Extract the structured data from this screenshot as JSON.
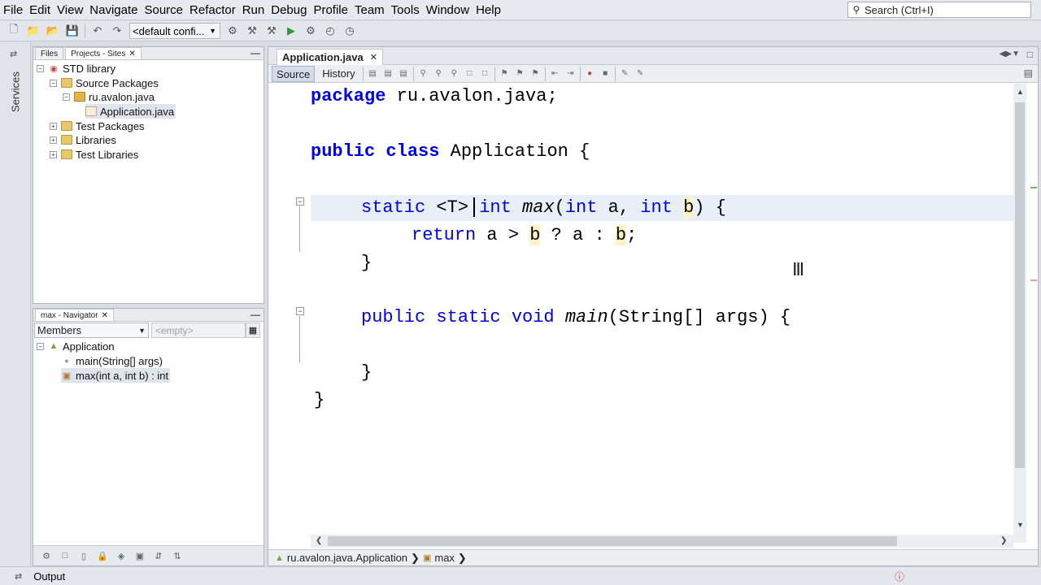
{
  "menu": [
    "File",
    "Edit",
    "View",
    "Navigate",
    "Source",
    "Refactor",
    "Run",
    "Debug",
    "Profile",
    "Team",
    "Tools",
    "Window",
    "Help"
  ],
  "search": {
    "placeholder": "Search (Ctrl+I)"
  },
  "toolbar": {
    "config": "<default confi..."
  },
  "left_strip": {
    "services": "Services"
  },
  "projects": {
    "tabs": [
      "Files",
      "Projects - Sites"
    ],
    "tree": [
      "STD library",
      "Source Packages",
      "ru.avalon.java",
      "Application.java",
      "Test Packages",
      "Libraries",
      "Test Libraries"
    ]
  },
  "navigator": {
    "title": "max - Navigator",
    "members": "Members",
    "filter_placeholder": "<empty>",
    "items": [
      "Application",
      "main(String[] args)",
      "max(int a, int b) : int"
    ]
  },
  "editor": {
    "tab": "Application.java",
    "modes": [
      "Source",
      "History"
    ],
    "code": {
      "l1_kw": "package",
      "l1_rest": " ru.avalon.java;",
      "l2_kw": "public class",
      "l2_rest": " Application {",
      "l3_a": "static",
      "l3_b": " <T> ",
      "l3_c": "int",
      "l3_d": "max",
      "l3_e": "(",
      "l3_f": "int",
      "l3_g": " a, ",
      "l3_h": "int",
      "l3_i": " ",
      "l3_j": "b",
      "l3_k": ") {",
      "l4_kw": "return",
      "l4_a": " a > ",
      "l4_b": "b",
      "l4_c": " ? a : ",
      "l4_d": "b",
      "l4_e": ";",
      "l5": "}",
      "l6_kw": "public static void",
      "l6_fn": "main",
      "l6_rest": "(String[] args) {",
      "l7": "}",
      "l8": "}"
    },
    "breadcrumb": [
      "ru.avalon.java.Application",
      "max"
    ]
  },
  "status": {
    "output": "Output"
  },
  "colors": {
    "keyword": "#0000e6",
    "current_line": "#e9eff8",
    "param_highlight": "#fff3c6"
  }
}
